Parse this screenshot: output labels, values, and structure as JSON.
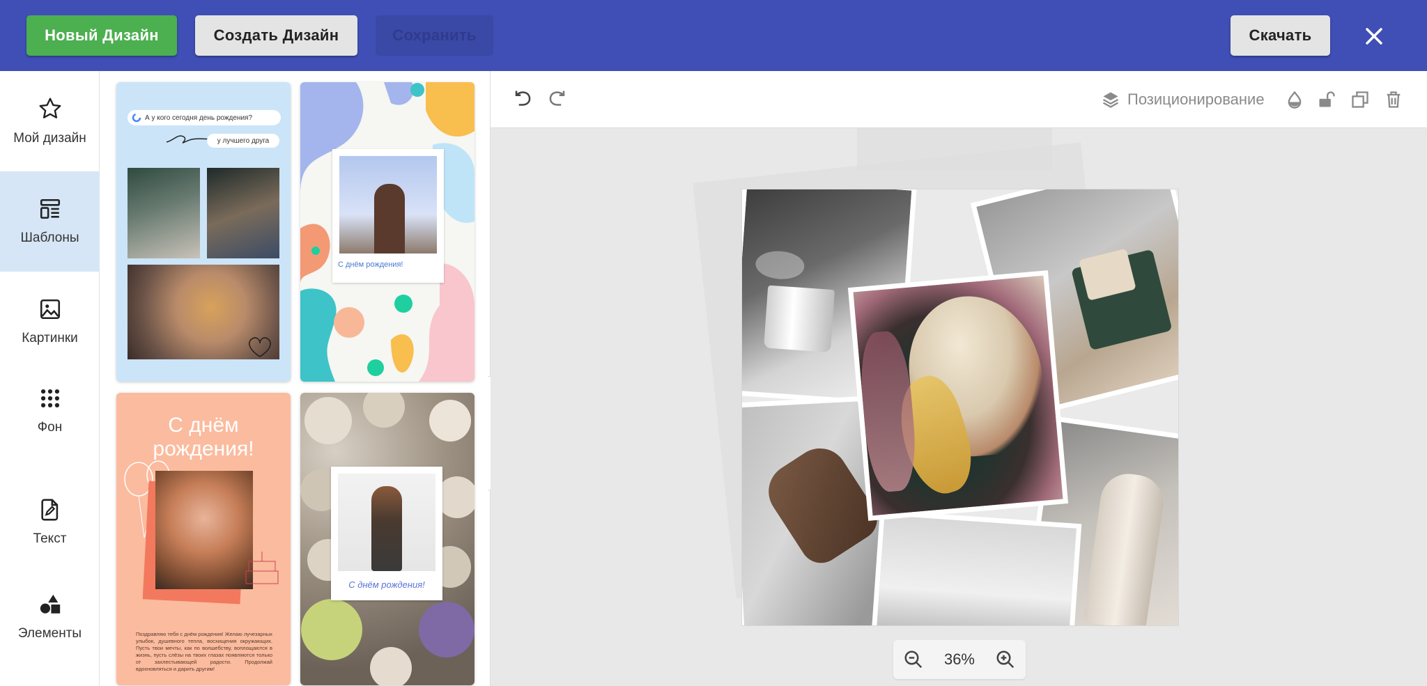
{
  "topbar": {
    "new_design": "Новый Дизайн",
    "create_design": "Создать Дизайн",
    "save": "Сохранить",
    "download": "Скачать",
    "accent": "#3f4fb5"
  },
  "sidebar": {
    "items": [
      {
        "label": "Мой дизайн",
        "icon": "star-icon"
      },
      {
        "label": "Шаблоны",
        "icon": "templates-icon"
      },
      {
        "label": "Картинки",
        "icon": "image-icon"
      },
      {
        "label": "Фон",
        "icon": "dots-grid-icon"
      },
      {
        "label": "Текст",
        "icon": "document-edit-icon"
      },
      {
        "label": "Элементы",
        "icon": "shapes-icon"
      }
    ]
  },
  "templates": {
    "t1": {
      "search": "А у кого сегодня день рождения?",
      "reply": "у лучшего друга"
    },
    "t2": {
      "caption": "С днём рождения!"
    },
    "t3": {
      "title_line1": "С днём",
      "title_line2": "рождения!",
      "body": "Поздравляю тебя с днём рождения! Желаю лучезарных улыбок, душевного тепла, восхищения окружающих. Пусть твои мечты, как по волшебству, воплощаются в жизнь, пусть слёзы на твоих глазах появляются только от захлестывающей радости. Продолжай вдохновляться и дарить другим!"
    },
    "t4": {
      "caption": "С днём рождения!"
    }
  },
  "toolbar": {
    "positioning": "Позиционирование"
  },
  "zoom": {
    "level": "36%"
  }
}
